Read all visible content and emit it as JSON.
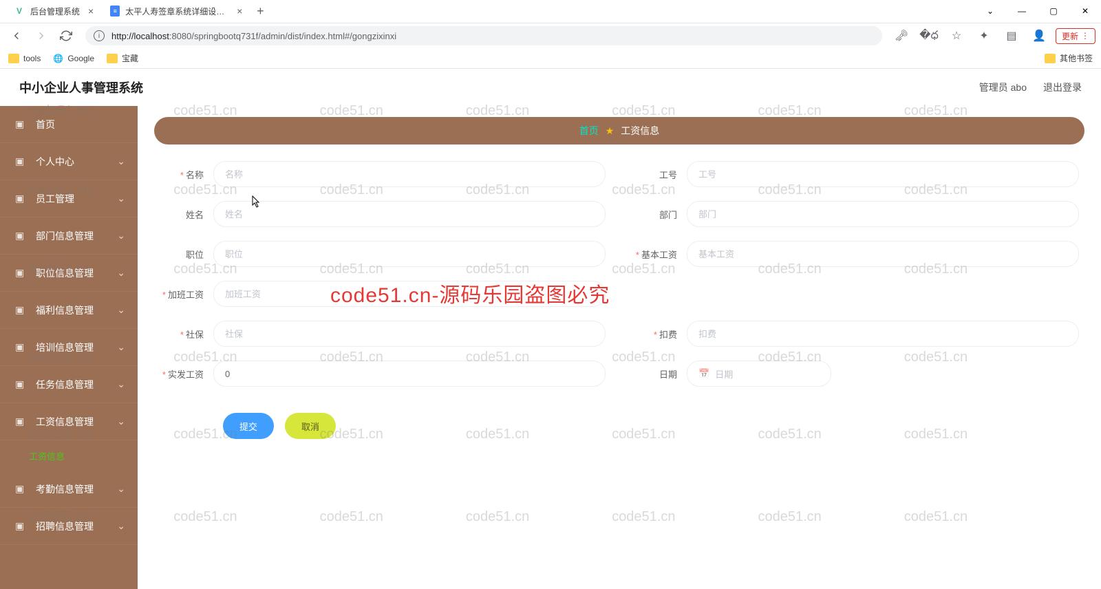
{
  "browser": {
    "tabs": [
      {
        "title": "后台管理系统",
        "active": true
      },
      {
        "title": "太平人寿签章系统详细设计文档",
        "active": false
      }
    ],
    "url_prefix": "http://",
    "url_host": "localhost",
    "url_port": ":8080",
    "url_path": "/springbootq731f/admin/dist/index.html#/gongzixinxi",
    "update_label": "更新",
    "bookmarks": [
      "tools",
      "Google",
      "宝藏"
    ],
    "other_bookmarks": "其他书签"
  },
  "header": {
    "title": "中小企业人事管理系统",
    "admin": "管理员 abo",
    "logout": "退出登录"
  },
  "sidebar": {
    "items": [
      {
        "label": "首页",
        "icon": "home"
      },
      {
        "label": "个人中心",
        "icon": "user",
        "expandable": true
      },
      {
        "label": "员工管理",
        "icon": "team",
        "expandable": true
      },
      {
        "label": "部门信息管理",
        "icon": "dept",
        "expandable": true
      },
      {
        "label": "职位信息管理",
        "icon": "post",
        "expandable": true
      },
      {
        "label": "福利信息管理",
        "icon": "welfare",
        "expandable": true
      },
      {
        "label": "培训信息管理",
        "icon": "train",
        "expandable": true
      },
      {
        "label": "任务信息管理",
        "icon": "task",
        "expandable": true
      },
      {
        "label": "工资信息管理",
        "icon": "salary",
        "expandable": true,
        "open": true
      },
      {
        "label": "考勤信息管理",
        "icon": "attend",
        "expandable": true
      },
      {
        "label": "招聘信息管理",
        "icon": "recruit",
        "expandable": true
      }
    ],
    "subitem": "工资信息"
  },
  "breadcrumb": {
    "home": "首页",
    "current": "工资信息"
  },
  "form": {
    "fields": [
      {
        "key": "name",
        "label": "名称",
        "placeholder": "名称",
        "required": true,
        "col": 0
      },
      {
        "key": "empno",
        "label": "工号",
        "placeholder": "工号",
        "required": false,
        "col": 1
      },
      {
        "key": "realname",
        "label": "姓名",
        "placeholder": "姓名",
        "required": false,
        "col": 0
      },
      {
        "key": "dept",
        "label": "部门",
        "placeholder": "部门",
        "required": false,
        "col": 1
      },
      {
        "key": "position",
        "label": "职位",
        "placeholder": "职位",
        "required": false,
        "col": 0
      },
      {
        "key": "base",
        "label": "基本工资",
        "placeholder": "基本工资",
        "required": true,
        "col": 1
      },
      {
        "key": "overtime",
        "label": "加班工资",
        "placeholder": "加班工资",
        "required": true,
        "col": 0
      },
      {
        "key": "shebao",
        "label": "社保",
        "placeholder": "社保",
        "required": true,
        "col": 0
      },
      {
        "key": "deduct",
        "label": "扣费",
        "placeholder": "扣费",
        "required": true,
        "col": 1
      },
      {
        "key": "net",
        "label": "实发工资",
        "placeholder": "",
        "value": "0",
        "required": true,
        "col": 0
      },
      {
        "key": "date",
        "label": "日期",
        "placeholder": "日期",
        "required": false,
        "type": "date",
        "col": 1
      }
    ],
    "submit": "提交",
    "cancel": "取消"
  },
  "watermark": {
    "text": "code51.cn",
    "big": "code51.cn-源码乐园盗图必究"
  }
}
